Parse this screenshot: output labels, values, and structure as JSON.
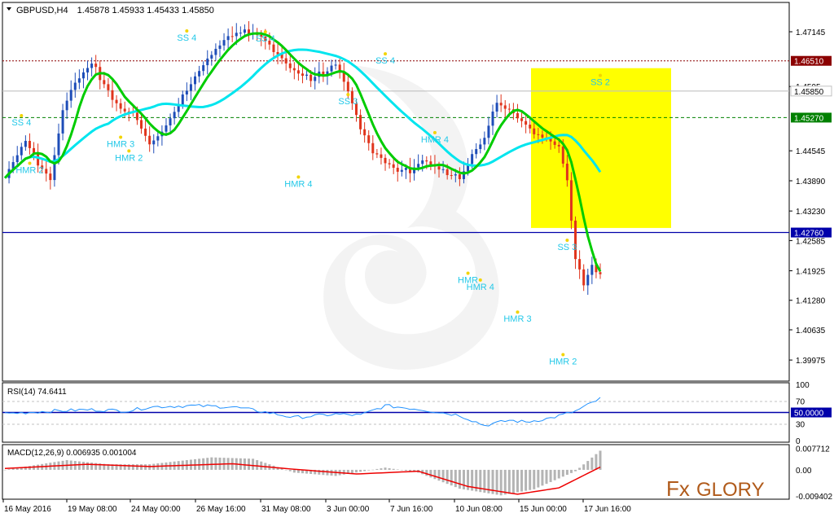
{
  "header": {
    "symbol": "GBPUSD,H4",
    "ohlc": "1.45878 1.45933 1.45433 1.45850"
  },
  "chart_data": [
    {
      "type": "candlestick",
      "title": "GBPUSD,H4",
      "ylim": [
        1.3955,
        1.4775
      ],
      "y_ticks": [
        1.47145,
        1.4595,
        1.44545,
        1.4389,
        1.4323,
        1.42585,
        1.41925,
        1.4128,
        1.40635,
        1.39975
      ],
      "y_tick_labels": [
        "1.47145",
        "1.4595",
        "1.44545",
        "1.43890",
        "1.43230",
        "1.42585",
        "1.41925",
        "1.41280",
        "1.40635",
        "1.39975"
      ],
      "x_labels": [
        "16 May 2016",
        "19 May 08:00",
        "24 May 00:00",
        "26 May 16:00",
        "31 May 08:00",
        "3 Jun 00:00",
        "7 Jun 16:00",
        "10 Jun 08:00",
        "15 Jun 00:00",
        "17 Jun 16:00"
      ],
      "n_bars": 145,
      "candle_anchors": [
        {
          "i": 0,
          "c": 1.4395
        },
        {
          "i": 5,
          "c": 1.4478
        },
        {
          "i": 8,
          "c": 1.4425
        },
        {
          "i": 11,
          "c": 1.4395
        },
        {
          "i": 14,
          "c": 1.4545
        },
        {
          "i": 17,
          "c": 1.4602
        },
        {
          "i": 21,
          "c": 1.4645
        },
        {
          "i": 25,
          "c": 1.4585
        },
        {
          "i": 28,
          "c": 1.4545
        },
        {
          "i": 31,
          "c": 1.4538
        },
        {
          "i": 35,
          "c": 1.4468
        },
        {
          "i": 38,
          "c": 1.4495
        },
        {
          "i": 42,
          "c": 1.4555
        },
        {
          "i": 46,
          "c": 1.4615
        },
        {
          "i": 50,
          "c": 1.4668
        },
        {
          "i": 54,
          "c": 1.4705
        },
        {
          "i": 58,
          "c": 1.4715
        },
        {
          "i": 62,
          "c": 1.4705
        },
        {
          "i": 66,
          "c": 1.4665
        },
        {
          "i": 70,
          "c": 1.4625
        },
        {
          "i": 74,
          "c": 1.4612
        },
        {
          "i": 78,
          "c": 1.4628
        },
        {
          "i": 80,
          "c": 1.4645
        },
        {
          "i": 83,
          "c": 1.4585
        },
        {
          "i": 86,
          "c": 1.4505
        },
        {
          "i": 89,
          "c": 1.4455
        },
        {
          "i": 92,
          "c": 1.443
        },
        {
          "i": 95,
          "c": 1.4415
        },
        {
          "i": 98,
          "c": 1.4408
        },
        {
          "i": 101,
          "c": 1.4438
        },
        {
          "i": 104,
          "c": 1.4418
        },
        {
          "i": 107,
          "c": 1.4405
        },
        {
          "i": 110,
          "c": 1.4392
        },
        {
          "i": 113,
          "c": 1.4445
        },
        {
          "i": 116,
          "c": 1.4485
        },
        {
          "i": 119,
          "c": 1.4558
        },
        {
          "i": 122,
          "c": 1.4545
        },
        {
          "i": 125,
          "c": 1.452
        },
        {
          "i": 128,
          "c": 1.4495
        },
        {
          "i": 131,
          "c": 1.448
        },
        {
          "i": 134,
          "c": 1.4465
        },
        {
          "i": 136,
          "c": 1.4388
        },
        {
          "i": 138,
          "c": 1.4218
        },
        {
          "i": 140,
          "c": 1.4162
        },
        {
          "i": 142,
          "c": 1.4205
        },
        {
          "i": 144,
          "c": 1.4185
        }
      ],
      "series": [
        {
          "name": "",
          "color": "#00cc00",
          "kind": "fast-ma"
        },
        {
          "name": "",
          "color": "#00e5ee",
          "kind": "slow-ma"
        }
      ],
      "horizontal_levels": [
        {
          "value": 1.4651,
          "label": "1.46510",
          "color": "#8b0000",
          "style": "dotted"
        },
        {
          "value": 1.4585,
          "label": "1.45850",
          "color": "#c0c0c0",
          "style": "solid"
        },
        {
          "value": 1.4527,
          "label": "1.45270",
          "color": "#008000",
          "style": "dashed"
        },
        {
          "value": 1.4276,
          "label": "1.42760",
          "color": "#0000aa",
          "style": "solid"
        }
      ],
      "highlight_zone": {
        "color": "#ffff00",
        "y_top": 1.4635,
        "y_bottom": 1.4286
      },
      "annotations": [
        {
          "text": "SS 4",
          "x_bar": 4,
          "y": 1.4517
        },
        {
          "text": "HMR 2",
          "x_bar": 6,
          "y": 1.4413
        },
        {
          "text": "HMR 3",
          "x_bar": 28,
          "y": 1.447
        },
        {
          "text": "HMR 2",
          "x_bar": 30,
          "y": 1.444
        },
        {
          "text": "SS 4",
          "x_bar": 44,
          "y": 1.4702
        },
        {
          "text": "SS 4",
          "x_bar": 63,
          "y": 1.47
        },
        {
          "text": "HMR 4",
          "x_bar": 71,
          "y": 1.4383
        },
        {
          "text": "SS 3",
          "x_bar": 83,
          "y": 1.4563
        },
        {
          "text": "SS 4",
          "x_bar": 92,
          "y": 1.4652
        },
        {
          "text": "HMR 4",
          "x_bar": 104,
          "y": 1.448
        },
        {
          "text": "HMR",
          "x_bar": 112,
          "y": 1.4173
        },
        {
          "text": "HMR 4",
          "x_bar": 115,
          "y": 1.4158
        },
        {
          "text": "HMR 3",
          "x_bar": 124,
          "y": 1.4088
        },
        {
          "text": "SS 3",
          "x_bar": 136,
          "y": 1.4245
        },
        {
          "text": "HMR 2",
          "x_bar": 135,
          "y": 1.3995
        },
        {
          "text": "SS 2",
          "x_bar": 144,
          "y": 1.4605
        }
      ]
    },
    {
      "type": "line",
      "title": "RSI(14) 74.6411",
      "ylim": [
        0,
        100
      ],
      "y_ticks": [
        100,
        70,
        30,
        0
      ],
      "y_tick_labels": [
        "100",
        "70",
        "30",
        "0"
      ],
      "levels": [
        {
          "value": 50,
          "label": "50.0000",
          "color": "#0000aa"
        }
      ],
      "last_value": 74.6411,
      "anchors": [
        {
          "i": 0,
          "v": 48
        },
        {
          "i": 10,
          "v": 52
        },
        {
          "i": 20,
          "v": 55
        },
        {
          "i": 30,
          "v": 53
        },
        {
          "i": 35,
          "v": 60
        },
        {
          "i": 45,
          "v": 62
        },
        {
          "i": 55,
          "v": 60
        },
        {
          "i": 62,
          "v": 52
        },
        {
          "i": 70,
          "v": 41
        },
        {
          "i": 80,
          "v": 47
        },
        {
          "i": 86,
          "v": 45
        },
        {
          "i": 92,
          "v": 62
        },
        {
          "i": 100,
          "v": 56
        },
        {
          "i": 110,
          "v": 45
        },
        {
          "i": 116,
          "v": 27
        },
        {
          "i": 122,
          "v": 36
        },
        {
          "i": 126,
          "v": 33
        },
        {
          "i": 132,
          "v": 40
        },
        {
          "i": 138,
          "v": 52
        },
        {
          "i": 144,
          "v": 74.6
        }
      ]
    },
    {
      "type": "bar+line",
      "title": "MACD(12,26,9) 0.006935 0.001004",
      "ylim": [
        -0.01,
        0.0085
      ],
      "y_ticks": [
        0.007712,
        0.0,
        -0.009402
      ],
      "y_tick_labels": [
        "0.007712",
        "0.00",
        "-0.009402"
      ],
      "histogram_last": 0.006935,
      "signal_last": 0.001004,
      "histogram_anchors": [
        {
          "i": 0,
          "v": 0.0
        },
        {
          "i": 15,
          "v": 0.0035
        },
        {
          "i": 25,
          "v": 0.002
        },
        {
          "i": 35,
          "v": 0.002
        },
        {
          "i": 50,
          "v": 0.0045
        },
        {
          "i": 60,
          "v": 0.004
        },
        {
          "i": 70,
          "v": -0.001
        },
        {
          "i": 80,
          "v": -0.0022
        },
        {
          "i": 92,
          "v": 0.0008
        },
        {
          "i": 100,
          "v": -0.001
        },
        {
          "i": 110,
          "v": -0.0068
        },
        {
          "i": 120,
          "v": -0.0092
        },
        {
          "i": 128,
          "v": -0.007
        },
        {
          "i": 138,
          "v": -0.0005
        },
        {
          "i": 144,
          "v": 0.0069
        }
      ],
      "signal_anchors": [
        {
          "i": 0,
          "v": 0.0005
        },
        {
          "i": 20,
          "v": 0.002
        },
        {
          "i": 35,
          "v": 0.0012
        },
        {
          "i": 55,
          "v": 0.0022
        },
        {
          "i": 70,
          "v": 0.0002
        },
        {
          "i": 85,
          "v": -0.0015
        },
        {
          "i": 100,
          "v": -0.0005
        },
        {
          "i": 112,
          "v": -0.006
        },
        {
          "i": 124,
          "v": -0.0088
        },
        {
          "i": 134,
          "v": -0.0065
        },
        {
          "i": 144,
          "v": 0.001
        }
      ]
    }
  ],
  "logo": {
    "text_fx": "Fx",
    "text_glory": "GLORY"
  }
}
